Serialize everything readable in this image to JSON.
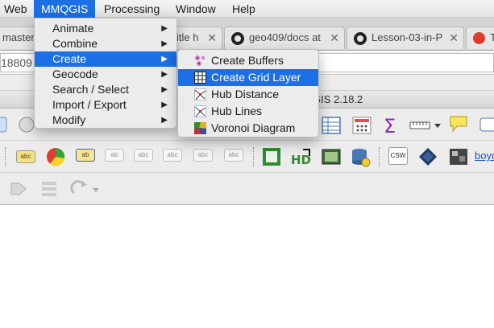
{
  "menubar": {
    "items": [
      "Web",
      "MMQGIS",
      "Processing",
      "Window",
      "Help"
    ]
  },
  "browser": {
    "tabs": [
      {
        "label": "master",
        "icon": "none"
      },
      {
        "label": "itle h",
        "icon": "none"
      },
      {
        "label": "geo409/docs at",
        "icon": "github-icon"
      },
      {
        "label": "Lesson-03-in-P",
        "icon": "github-icon"
      },
      {
        "label": "T",
        "icon": "tomato-icon"
      }
    ],
    "url_fragment": "18809"
  },
  "qgis": {
    "title_fragment": "GIS 2.18.2"
  },
  "toolbar": {
    "csw_label": "CSW",
    "boyd_label": "boyd",
    "abc_label": "abc",
    "ab_label": "ab"
  },
  "mmqgis_menu": {
    "items": [
      {
        "label": "Animate",
        "has_submenu": true
      },
      {
        "label": "Combine",
        "has_submenu": true
      },
      {
        "label": "Create",
        "has_submenu": true,
        "highlighted": true
      },
      {
        "label": "Geocode",
        "has_submenu": true
      },
      {
        "label": "Search / Select",
        "has_submenu": true
      },
      {
        "label": "Import / Export",
        "has_submenu": true
      },
      {
        "label": "Modify",
        "has_submenu": true
      }
    ]
  },
  "create_submenu": {
    "items": [
      {
        "label": "Create Buffers",
        "icon": "buffers-icon"
      },
      {
        "label": "Create Grid Layer",
        "icon": "grid-icon",
        "highlighted": true
      },
      {
        "label": "Hub Distance",
        "icon": "hub-distance-icon"
      },
      {
        "label": "Hub Lines",
        "icon": "hub-lines-icon"
      },
      {
        "label": "Voronoi Diagram",
        "icon": "voronoi-icon"
      }
    ]
  },
  "colors": {
    "highlight": "#1c6fe4",
    "menu_bg": "#ececec"
  }
}
